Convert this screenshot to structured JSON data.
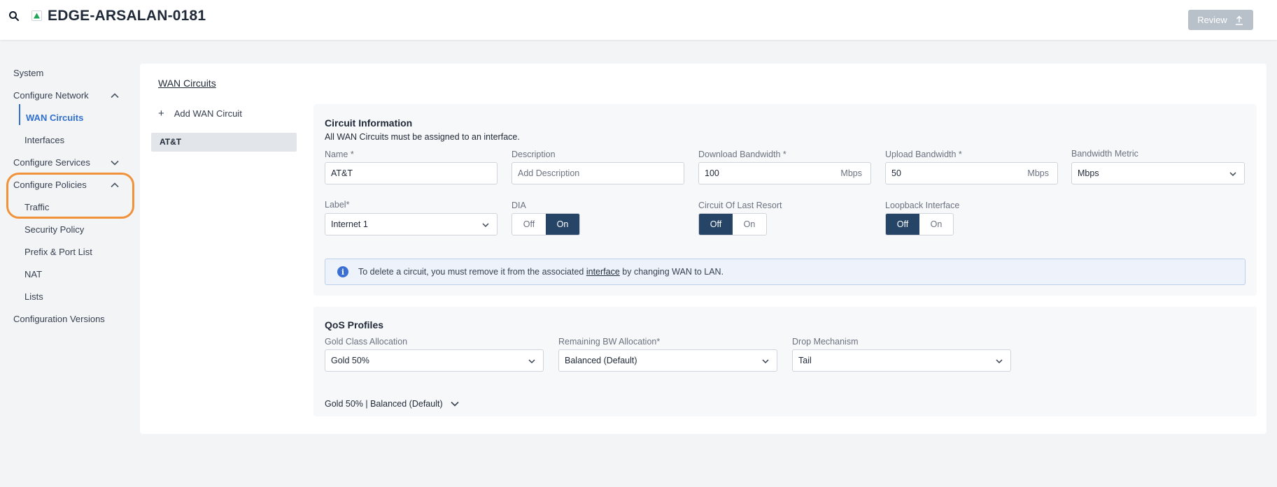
{
  "header": {
    "device_name": "EDGE-ARSALAN-0181",
    "review_label": "Review"
  },
  "sidebar": {
    "items": [
      {
        "label": "System"
      },
      {
        "label": "Configure Network"
      },
      {
        "label": "WAN Circuits"
      },
      {
        "label": "Interfaces"
      },
      {
        "label": "Configure Services"
      },
      {
        "label": "Configure Policies"
      },
      {
        "label": "Traffic"
      },
      {
        "label": "Security Policy"
      },
      {
        "label": "Prefix & Port List"
      },
      {
        "label": "NAT"
      },
      {
        "label": "Lists"
      },
      {
        "label": "Configuration Versions"
      }
    ]
  },
  "main": {
    "title": "WAN Circuits",
    "add_circuit_label": "Add WAN Circuit",
    "circuits": [
      "AT&T"
    ]
  },
  "circuit_info": {
    "title": "Circuit Information",
    "subtitle": "All WAN Circuits must be assigned to an interface.",
    "name_label": "Name *",
    "name_value": "AT&T",
    "description_label": "Description",
    "description_placeholder": "Add Description",
    "download_label": "Download Bandwidth *",
    "download_value": "100",
    "download_unit": "Mbps",
    "upload_label": "Upload Bandwidth *",
    "upload_value": "50",
    "upload_unit": "Mbps",
    "metric_label": "Bandwidth Metric",
    "metric_value": "Mbps",
    "label_label": "Label*",
    "label_value": "Internet 1",
    "dia_label": "DIA",
    "dia_off": "Off",
    "dia_on": "On",
    "last_resort_label": "Circuit Of Last Resort",
    "last_resort_off": "Off",
    "last_resort_on": "On",
    "loopback_label": "Loopback Interface",
    "loopback_off": "Off",
    "loopback_on": "On",
    "info_prefix": "To delete a circuit, you must remove it from the associated",
    "info_link": "interface",
    "info_suffix": "by changing WAN to LAN."
  },
  "qos": {
    "title": "QoS Profiles",
    "gold_label": "Gold Class Allocation",
    "gold_value": "Gold 50%",
    "remaining_label": "Remaining BW Allocation*",
    "remaining_value": "Balanced (Default)",
    "drop_label": "Drop Mechanism",
    "drop_value": "Tail",
    "summary": "Gold 50% | Balanced (Default)"
  },
  "colors": {
    "accent": "#2f6fd1",
    "toggle_selected": "#264466",
    "highlight": "#f0923a"
  }
}
